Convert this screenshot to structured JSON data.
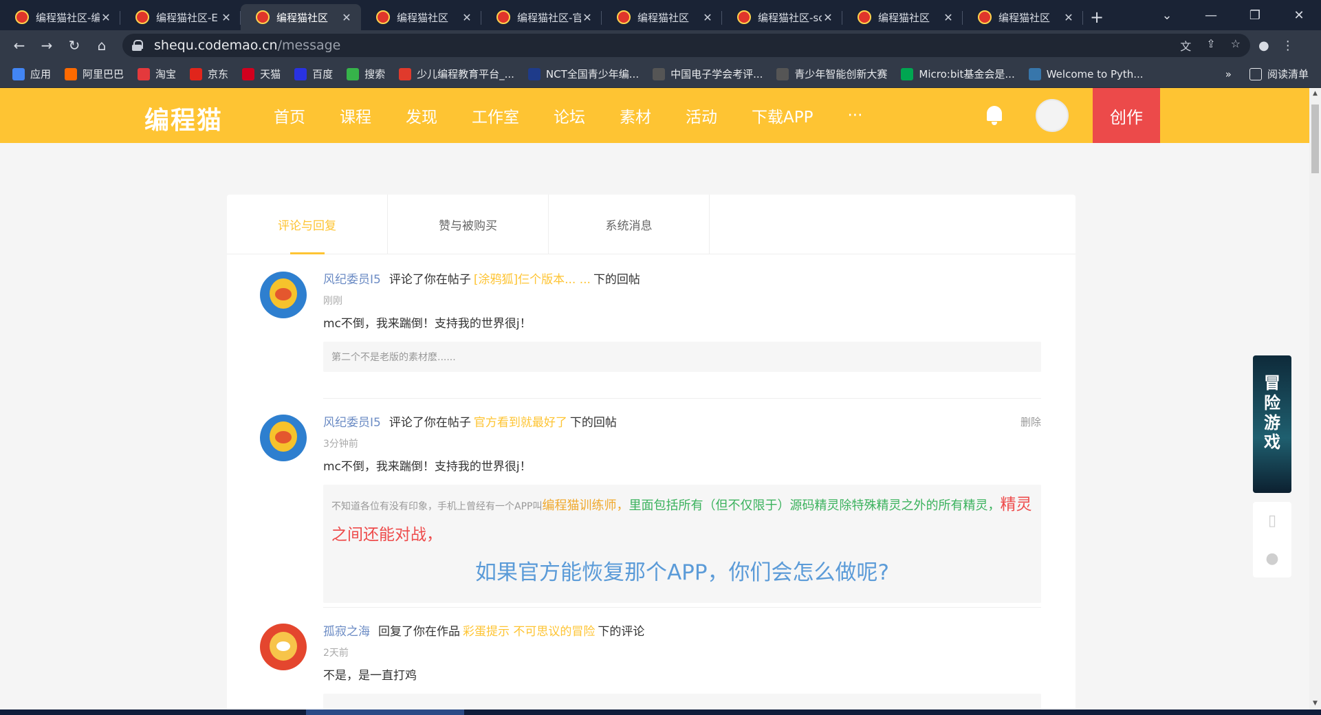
{
  "browser": {
    "tabs": [
      {
        "title": "编程猫社区-编",
        "active": false
      },
      {
        "title": "编程猫社区-E",
        "active": false
      },
      {
        "title": "编程猫社区",
        "active": true
      },
      {
        "title": "编程猫社区",
        "active": false
      },
      {
        "title": "编程猫社区-官",
        "active": false
      },
      {
        "title": "编程猫社区",
        "active": false
      },
      {
        "title": "编程猫社区-sc",
        "active": false
      },
      {
        "title": "编程猫社区",
        "active": false
      },
      {
        "title": "编程猫社区",
        "active": false
      }
    ],
    "url_host": "shequ.codemao.cn",
    "url_path": "/message",
    "bookmarks": [
      {
        "label": "应用",
        "color": "#4285f4"
      },
      {
        "label": "阿里巴巴",
        "color": "#ff6a00"
      },
      {
        "label": "淘宝",
        "color": "#e4393c"
      },
      {
        "label": "京东",
        "color": "#e1251b"
      },
      {
        "label": "天猫",
        "color": "#d2001e"
      },
      {
        "label": "百度",
        "color": "#2932e1"
      },
      {
        "label": "搜索",
        "color": "#36b34a"
      },
      {
        "label": "少儿编程教育平台_...",
        "color": "#e03a2c"
      },
      {
        "label": "NCT全国青少年编...",
        "color": "#1e3b8a"
      },
      {
        "label": "中国电子学会考评...",
        "color": "#555555"
      },
      {
        "label": "青少年智能创新大赛",
        "color": "#555555"
      },
      {
        "label": "Micro:bit基金会是...",
        "color": "#00a651"
      },
      {
        "label": "Welcome to Pyth...",
        "color": "#3776ab"
      }
    ],
    "bookmarks_more": "»",
    "reading_list": "阅读清单"
  },
  "site": {
    "logo": "编程猫",
    "nav": [
      "首页",
      "课程",
      "发现",
      "工作室",
      "论坛",
      "素材",
      "活动",
      "下载APP",
      "···"
    ],
    "create_label": "创作"
  },
  "message_tabs": [
    "评论与回复",
    "赞与被购买",
    "系统消息"
  ],
  "messages": [
    {
      "user": "风纪委员I5",
      "action": "评论了你在帖子",
      "target": "[涂鸦狐]仨个版本... ...",
      "suffix": "下的回帖",
      "time": "刚刚",
      "content": "mc不倒，我来踹倒！支持我的世界很j！",
      "quote": "第二个不是老版的素材麽......"
    },
    {
      "user": "风纪委员I5",
      "action": "评论了你在帖子",
      "target": "官方看到就最好了",
      "suffix": "下的回帖",
      "time": "3分钟前",
      "content": "mc不倒，我来踹倒！支持我的世界很j！",
      "delete_label": "删除",
      "quote_parts": {
        "p1": "不知道各位有没有印象，手机上曾经有一个APP叫",
        "p2": "编程猫训练师，",
        "p3": "里面包括所有（但不仅限于）源码精灵除特殊精灵之外的所有精灵，",
        "p4": "精灵之间还能对战，",
        "p5": "如果官方能恢复那个APP，你们会怎么做呢?"
      }
    },
    {
      "user": "孤寂之海",
      "action": "回复了你在作品",
      "target": "彩蛋提示 不可思议的冒险",
      "suffix": "下的评论",
      "time": "2天前",
      "content": "不是，是一直打鸡"
    }
  ],
  "side_ad": {
    "text": "冒险游戏"
  },
  "colors": {
    "brand_yellow": "#fec433",
    "create_red": "#ec4a4a",
    "user_blue": "#6b8bc4"
  }
}
